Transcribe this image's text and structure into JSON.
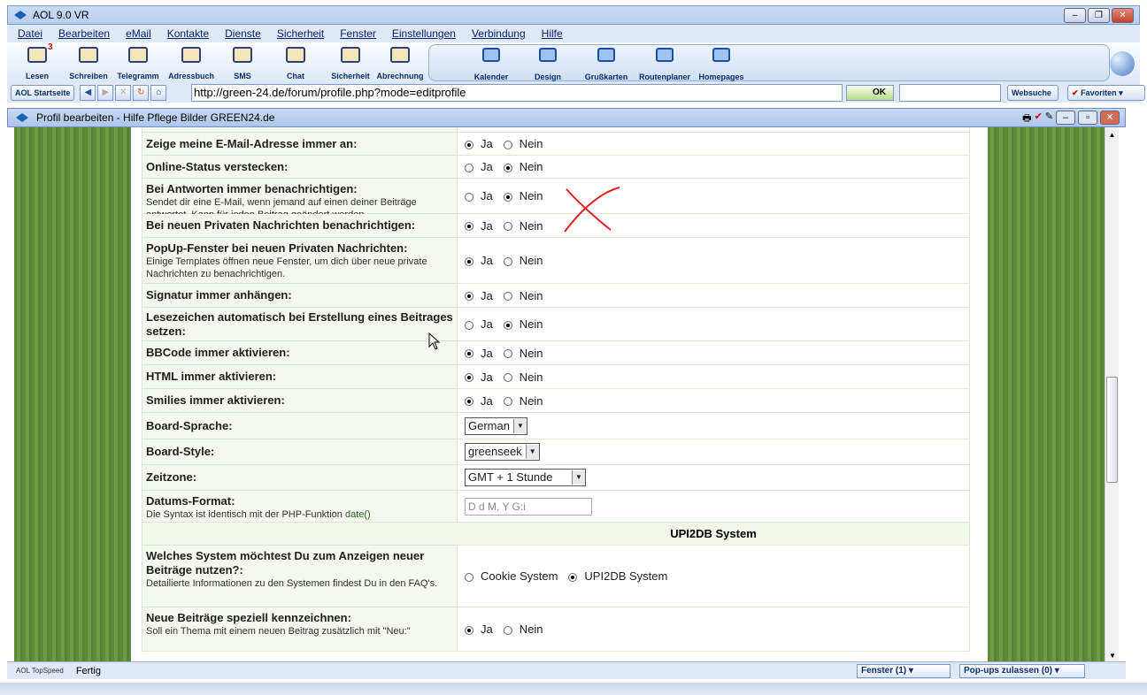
{
  "window": {
    "title": "AOL 9.0 VR"
  },
  "menu": [
    "Datei",
    "Bearbeiten",
    "eMail",
    "Kontakte",
    "Dienste",
    "Sicherheit",
    "Fenster",
    "Einstellungen",
    "Verbindung",
    "Hilfe"
  ],
  "toolbar": {
    "left": [
      {
        "label": "Lesen",
        "icon": "envelope-icon",
        "badge": "3"
      },
      {
        "label": "Schreiben",
        "icon": "pencil-icon"
      },
      {
        "label": "Telegramm",
        "icon": "aim-icon"
      },
      {
        "label": "Adressbuch",
        "icon": "addressbook-icon"
      },
      {
        "label": "SMS",
        "icon": "phone-icon"
      },
      {
        "label": "Chat",
        "icon": "chat-icon"
      },
      {
        "label": "Sicherheit",
        "icon": "shield-icon"
      },
      {
        "label": "Abrechnung",
        "icon": "user-icon"
      }
    ],
    "group": [
      {
        "label": "Kalender",
        "icon": "calendar-icon"
      },
      {
        "label": "Design",
        "icon": "palette-icon"
      },
      {
        "label": "Grußkarten",
        "icon": "card-icon"
      },
      {
        "label": "Routenplaner",
        "icon": "compass-icon"
      },
      {
        "label": "Homepages",
        "icon": "house-icon"
      }
    ]
  },
  "nav": {
    "startseite": "AOL Startseite",
    "url": "http://green-24.de/forum/profile.php?mode=editprofile",
    "ok": "OK",
    "websuche": "Websuche",
    "favoriten": "Favoriten"
  },
  "inner": {
    "title": "Profil bearbeiten - Hilfe Pflege Bilder GREEN24.de"
  },
  "form": {
    "rows": [
      {
        "label": "Zeige meine E-Mail-Adresse immer an:",
        "desc": "",
        "opt1": "Ja",
        "opt2": "Nein",
        "selected": 1
      },
      {
        "label": "Online-Status verstecken:",
        "desc": "",
        "opt1": "Ja",
        "opt2": "Nein",
        "selected": 2
      },
      {
        "label": "Bei Antworten immer benachrichtigen:",
        "desc": "Sendet dir eine E-Mail, wenn jemand auf einen deiner Beiträge antwortet. Kann für jeden Beitrag geändert werden.",
        "opt1": "Ja",
        "opt2": "Nein",
        "selected": 2
      },
      {
        "label": "Bei neuen Privaten Nachrichten benachrichtigen:",
        "desc": "",
        "opt1": "Ja",
        "opt2": "Nein",
        "selected": 1
      },
      {
        "label": "PopUp-Fenster bei neuen Privaten Nachrichten:",
        "desc": "Einige Templates öffnen neue Fenster, um dich über neue private Nachrichten zu benachrichtigen.",
        "opt1": "Ja",
        "opt2": "Nein",
        "selected": 1
      },
      {
        "label": "Signatur immer anhängen:",
        "desc": "",
        "opt1": "Ja",
        "opt2": "Nein",
        "selected": 1
      },
      {
        "label": "Lesezeichen automatisch bei Erstellung eines Beitrages setzen:",
        "desc": "",
        "opt1": "Ja",
        "opt2": "Nein",
        "selected": 2
      },
      {
        "label": "BBCode immer aktivieren:",
        "desc": "",
        "opt1": "Ja",
        "opt2": "Nein",
        "selected": 1
      },
      {
        "label": "HTML immer aktivieren:",
        "desc": "",
        "opt1": "Ja",
        "opt2": "Nein",
        "selected": 1
      },
      {
        "label": "Smilies immer aktivieren:",
        "desc": "",
        "opt1": "Ja",
        "opt2": "Nein",
        "selected": 1
      }
    ],
    "sprache": {
      "label": "Board-Sprache:",
      "value": "German"
    },
    "style": {
      "label": "Board-Style:",
      "value": "greenseek"
    },
    "zeitzone": {
      "label": "Zeitzone:",
      "value": "GMT + 1 Stunde"
    },
    "datum": {
      "label": "Datums-Format:",
      "desc_prefix": "Die Syntax ist identisch mit der PHP-Funktion ",
      "desc_link": "date()",
      "value": "D d M, Y G:i"
    },
    "section": "UPI2DB System",
    "system": {
      "label": "Welches System möchtest Du zum Anzeigen neuer Beiträge nutzen?:",
      "desc": "Detailierte Informationen zu den Systemen findest Du in den FAQ's.",
      "opt1": "Cookie System",
      "opt2": "UPI2DB System",
      "selected": 2
    },
    "neu": {
      "label": "Neue Beiträge speziell kennzeichnen:",
      "desc": "Soll ein Thema mit einem neuen Beitrag zusätzlich mit \"Neu:\"",
      "opt1": "Ja",
      "opt2": "Nein",
      "selected": 1
    }
  },
  "status": {
    "topspeed": "AOL TopSpeed",
    "text": "Fertig",
    "fenster": "Fenster (1)",
    "popups": "Pop-ups zulassen (0)"
  }
}
